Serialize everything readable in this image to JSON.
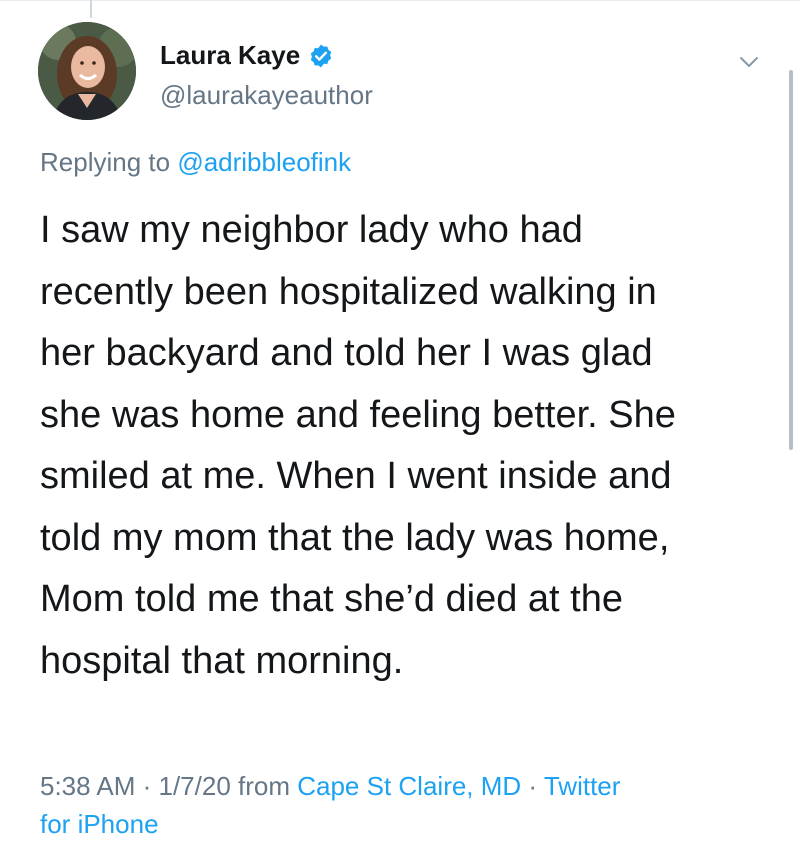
{
  "author": {
    "display_name": "Laura Kaye",
    "handle": "@laurakayeauthor",
    "verified": true
  },
  "reply": {
    "prefix": "Replying to ",
    "mention": "@adribbleofink"
  },
  "tweet": {
    "lines": [
      "I saw my neighbor lady who had",
      "recently been hospitalized walking in",
      "her backyard and told her I was glad",
      "she was home and feeling better. She",
      "smiled at me. When I went inside and",
      "told my mom that the lady was home,",
      "Mom told me that she’d died at the",
      "hospital that morning."
    ]
  },
  "meta": {
    "timestamp": "5:38 AM · 1/7/20 from ",
    "location": "Cape St Claire, MD",
    "separator": " · ",
    "source_line1": "Twitter",
    "source_line2": "for iPhone"
  },
  "colors": {
    "link": "#1da1f2",
    "secondary_text": "#657786",
    "primary_text": "#14171a"
  },
  "icons": {
    "verified": "verified-badge-icon",
    "menu": "chevron-down-icon"
  }
}
